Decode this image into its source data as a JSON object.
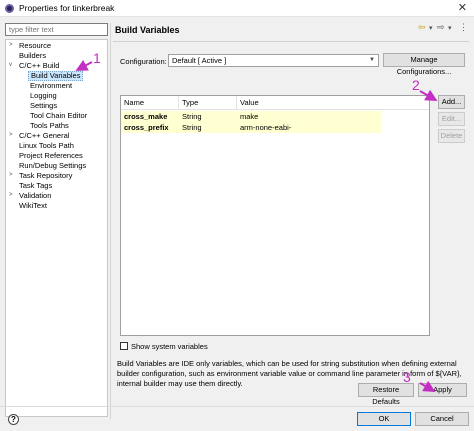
{
  "window": {
    "title": "Properties for tinkerbreak",
    "close_glyph": "✕",
    "icon": "eclipse-icon"
  },
  "sidebar": {
    "filter_placeholder": "type filter text",
    "items": [
      {
        "label": "Resource",
        "twisty": ">"
      },
      {
        "label": "Builders",
        "twisty": ""
      },
      {
        "label": "C/C++ Build",
        "twisty": "v"
      },
      {
        "label": "Build Variables",
        "twisty": ""
      },
      {
        "label": "Environment",
        "twisty": ""
      },
      {
        "label": "Logging",
        "twisty": ""
      },
      {
        "label": "Settings",
        "twisty": ""
      },
      {
        "label": "Tool Chain Editor",
        "twisty": ""
      },
      {
        "label": "Tools Paths",
        "twisty": ""
      },
      {
        "label": "C/C++ General",
        "twisty": ">"
      },
      {
        "label": "Linux Tools Path",
        "twisty": ""
      },
      {
        "label": "Project References",
        "twisty": ""
      },
      {
        "label": "Run/Debug Settings",
        "twisty": ""
      },
      {
        "label": "Task Repository",
        "twisty": ">"
      },
      {
        "label": "Task Tags",
        "twisty": ""
      },
      {
        "label": "Validation",
        "twisty": ">"
      },
      {
        "label": "WikiText",
        "twisty": ""
      }
    ]
  },
  "header": {
    "title": "Build Variables",
    "back_glyph": "⇦",
    "back_dropdown_glyph": "▾",
    "forward_glyph": "⇨",
    "forward_dropdown_glyph": "▾",
    "menu_glyph": "⋮"
  },
  "configuration": {
    "label": "Configuration:",
    "value": "Default  [ Active ]",
    "dropdown_glyph": "▼",
    "manage_button": "Manage Configurations..."
  },
  "table": {
    "columns": [
      "Name",
      "Type",
      "Value"
    ],
    "rows": [
      {
        "name": "cross_make",
        "type": "String",
        "value": "make"
      },
      {
        "name": "cross_prefix",
        "type": "String",
        "value": "arm-none-eabi-"
      }
    ]
  },
  "actions": {
    "add": "Add...",
    "edit": "Edit...",
    "delete": "Delete"
  },
  "show_system_variables": "Show system variables",
  "description": "Build Variables are IDE only variables, which can be used for string substitution when defining external builder configuration, such as environment variable value or command line parameter in form of ${VAR}, internal builder may use them directly.",
  "buttons": {
    "restore_defaults": "Restore Defaults",
    "apply": "Apply",
    "ok": "OK",
    "cancel": "Cancel",
    "help": "?"
  },
  "annotations": {
    "marker_1": "1",
    "marker_2": "2",
    "marker_3": "3",
    "color": "#c32ec3"
  }
}
